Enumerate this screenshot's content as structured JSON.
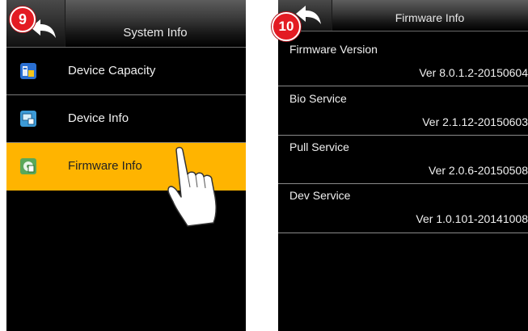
{
  "left_screen": {
    "title": "System Info",
    "menu": [
      {
        "label": "Device Capacity",
        "icon": "device-capacity-icon"
      },
      {
        "label": "Device Info",
        "icon": "device-info-icon"
      },
      {
        "label": "Firmware Info",
        "icon": "firmware-info-icon",
        "selected": true
      }
    ]
  },
  "right_screen": {
    "title": "Firmware Info",
    "items": [
      {
        "key": "Firmware Version",
        "value": "Ver 8.0.1.2-20150604"
      },
      {
        "key": "Bio Service",
        "value": "Ver 2.1.12-20150603"
      },
      {
        "key": "Pull Service",
        "value": "Ver 2.0.6-20150508"
      },
      {
        "key": "Dev Service",
        "value": "Ver 1.0.101-20141008"
      }
    ]
  },
  "badges": {
    "step1": "9",
    "step2": "10"
  },
  "colors": {
    "selected": "#ffb400",
    "badge": "#e31b23",
    "background": "#000000"
  }
}
